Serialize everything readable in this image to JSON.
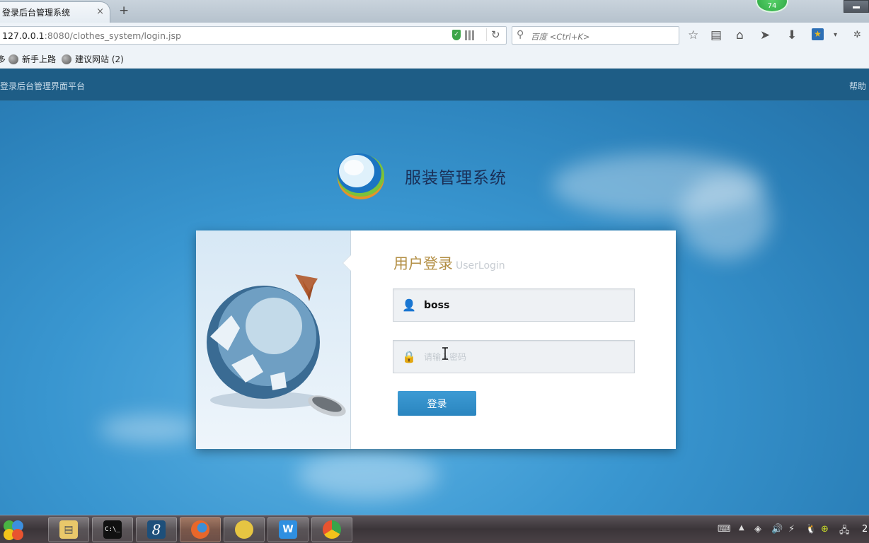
{
  "browser": {
    "tab_title": "登录后台管理系统",
    "tab_close": "×",
    "new_tab": "+",
    "notification_count": "74",
    "url_host": "127.0.0.1",
    "url_rest": ":8080/clothes_system/login.jsp",
    "search_placeholder": "百度 <Ctrl+K>",
    "bookmarks": [
      {
        "label": "多"
      },
      {
        "label": "新手上路"
      },
      {
        "label": "建议网站 (2)"
      }
    ],
    "toolbar_icons": [
      "bookmark-star-icon",
      "reading-list-icon",
      "home-icon",
      "send-icon",
      "download-icon",
      "extension-icon",
      "dropdown-icon",
      "more-icon"
    ]
  },
  "page": {
    "header_title": "登录后台管理界面平台",
    "help_link": "帮助",
    "brand_title": "服装管理系统",
    "login": {
      "title": "用户登录",
      "subtitle": "UserLogin",
      "username_value": "boss",
      "password_placeholder": "请输入密码",
      "submit_label": "登录"
    }
  },
  "taskbar": {
    "apps": [
      {
        "name": "file-explorer",
        "glyph": "▤",
        "color": "#e9c86a"
      },
      {
        "name": "command-prompt",
        "glyph": "C:\\_",
        "color": "#111111"
      },
      {
        "name": "app-8",
        "glyph": "8",
        "color": "#1d4f7a"
      },
      {
        "name": "firefox",
        "glyph": "●",
        "color": "#e8672a"
      },
      {
        "name": "app-yellow",
        "glyph": "●",
        "color": "#e6c542"
      },
      {
        "name": "wps-writer",
        "glyph": "W",
        "color": "#2f8fe0"
      },
      {
        "name": "browser-360",
        "glyph": "◉",
        "color": "#3aa34a"
      }
    ],
    "clock": "2"
  }
}
